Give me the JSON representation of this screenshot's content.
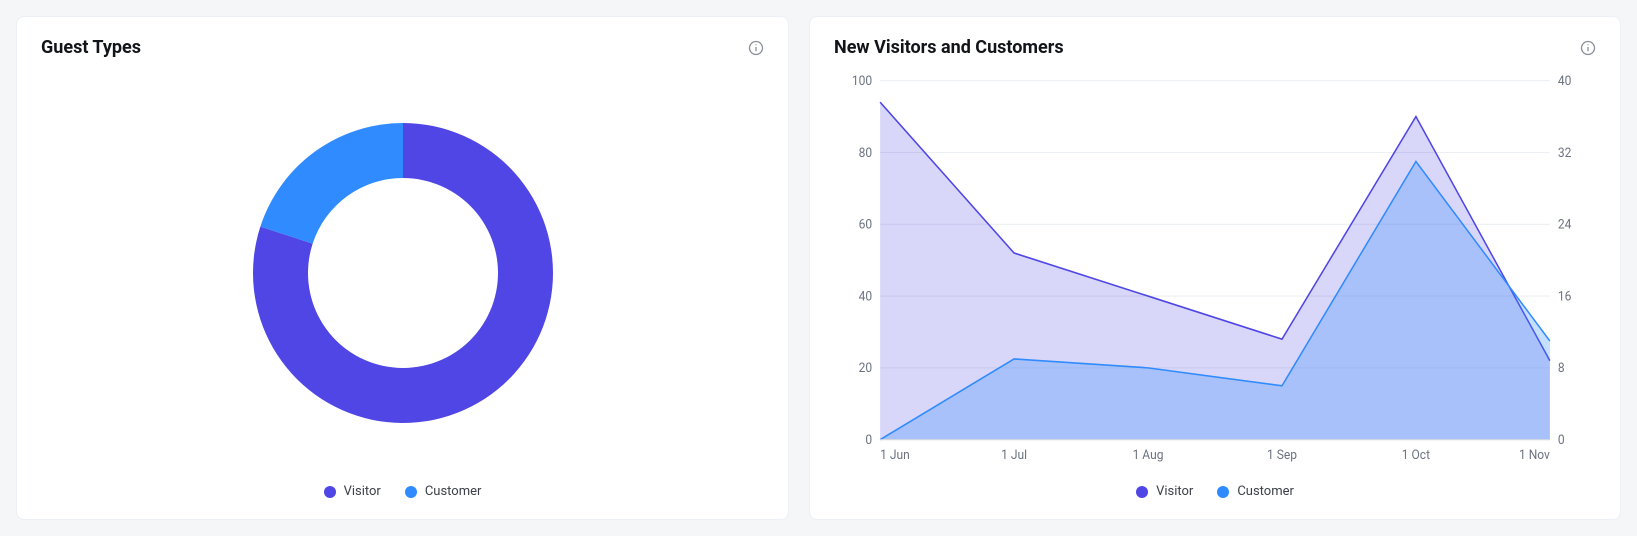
{
  "colors": {
    "visitor": "#4F46E5",
    "customer": "#2F8BFF",
    "visitor_fill": "rgba(79,70,229,0.22)",
    "customer_fill": "rgba(47,139,255,0.28)"
  },
  "card_left": {
    "title": "Guest Types",
    "legend": {
      "visitor": "Visitor",
      "customer": "Customer"
    }
  },
  "card_right": {
    "title": "New Visitors and Customers",
    "legend": {
      "visitor": "Visitor",
      "customer": "Customer"
    }
  },
  "chart_data": [
    {
      "type": "pie",
      "title": "Guest Types",
      "series": [
        {
          "name": "Visitor",
          "value": 80
        },
        {
          "name": "Customer",
          "value": 20
        }
      ]
    },
    {
      "type": "area",
      "title": "New Visitors and Customers",
      "categories": [
        "1 Jun",
        "1 Jul",
        "1 Aug",
        "1 Sep",
        "1 Oct",
        "1 Nov"
      ],
      "left_axis": {
        "label": "",
        "ylim": [
          0,
          100
        ],
        "ticks": [
          0,
          20,
          40,
          60,
          80,
          100
        ]
      },
      "right_axis": {
        "label": "",
        "ylim": [
          0,
          40
        ],
        "ticks": [
          0,
          8,
          16,
          24,
          32,
          40
        ]
      },
      "series": [
        {
          "name": "Visitor",
          "axis": "left",
          "values": [
            94,
            52,
            40,
            28,
            90,
            22
          ]
        },
        {
          "name": "Customer",
          "axis": "right",
          "values": [
            0,
            9,
            8,
            6,
            31,
            11
          ]
        }
      ]
    }
  ]
}
